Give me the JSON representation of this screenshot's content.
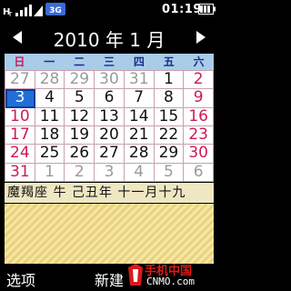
{
  "status": {
    "network": "3G",
    "time": "01:19"
  },
  "header": {
    "month_title": "2010 年 1 月"
  },
  "calendar": {
    "weekdays": [
      "日",
      "一",
      "二",
      "三",
      "四",
      "五",
      "六"
    ],
    "weeks": [
      [
        "27",
        "28",
        "29",
        "30",
        "31",
        "1",
        "2"
      ],
      [
        "3",
        "4",
        "5",
        "6",
        "7",
        "8",
        "9"
      ],
      [
        "10",
        "11",
        "12",
        "13",
        "14",
        "15",
        "16"
      ],
      [
        "17",
        "18",
        "19",
        "20",
        "21",
        "22",
        "23"
      ],
      [
        "24",
        "25",
        "26",
        "27",
        "28",
        "29",
        "30"
      ],
      [
        "31",
        "1",
        "2",
        "3",
        "4",
        "5",
        "6"
      ]
    ],
    "selected_day": "3"
  },
  "lunar_info": "魔羯座 牛 己丑年 十一月十九",
  "softkeys": {
    "left": "选项",
    "right": "新建"
  },
  "watermark": {
    "brand": "手机中国",
    "site": "CNMO.com"
  },
  "colors": {
    "weekday_header": "#a9cde8",
    "sunday": "#cc1a5a",
    "today": "#1f6fd6",
    "lunar_bg": "#efe7c2",
    "memo_bg": "#e9d27a"
  }
}
